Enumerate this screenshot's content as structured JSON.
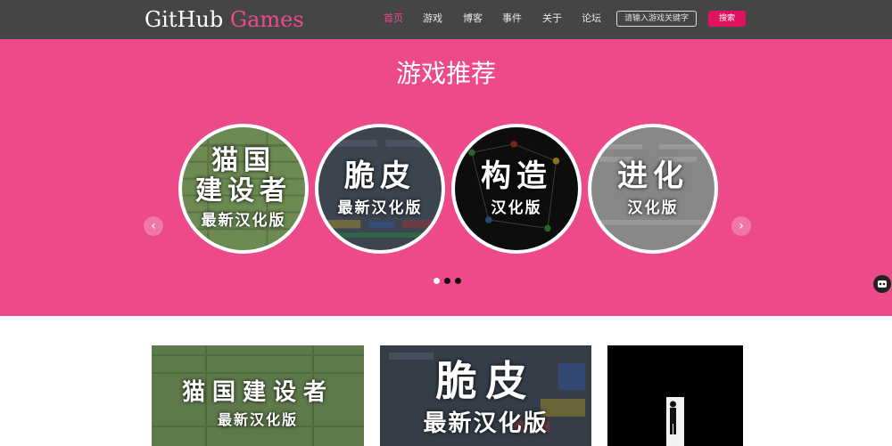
{
  "header": {
    "brand_part1": "GitHub",
    "brand_part2": "Games",
    "nav": [
      "首页",
      "游戏",
      "博客",
      "事件",
      "关于",
      "论坛"
    ],
    "search_placeholder": "请输入游戏关键字",
    "search_button": "搜索",
    "active_color": "#ec4a8a",
    "bar_color": "#454545"
  },
  "hero": {
    "title": "游戏推荐",
    "background": "#ec4a88",
    "slides": [
      {
        "title_line1": "猫国",
        "title_line2": "建设者",
        "subtitle": "最新汉化版"
      },
      {
        "title_line1": "脆皮",
        "subtitle": "最新汉化版"
      },
      {
        "title_line1": "构造",
        "subtitle": "汉化版"
      },
      {
        "title_line1": "进化",
        "subtitle": "汉化版"
      }
    ],
    "prev_icon": "‹",
    "next_icon": "›",
    "pager_count": 3,
    "pager_active": 1
  },
  "cards": [
    {
      "title": "猫国建设者",
      "subtitle": "最新汉化版"
    },
    {
      "title": "脆皮",
      "subtitle": "最新汉化版"
    },
    {
      "title": ""
    }
  ]
}
